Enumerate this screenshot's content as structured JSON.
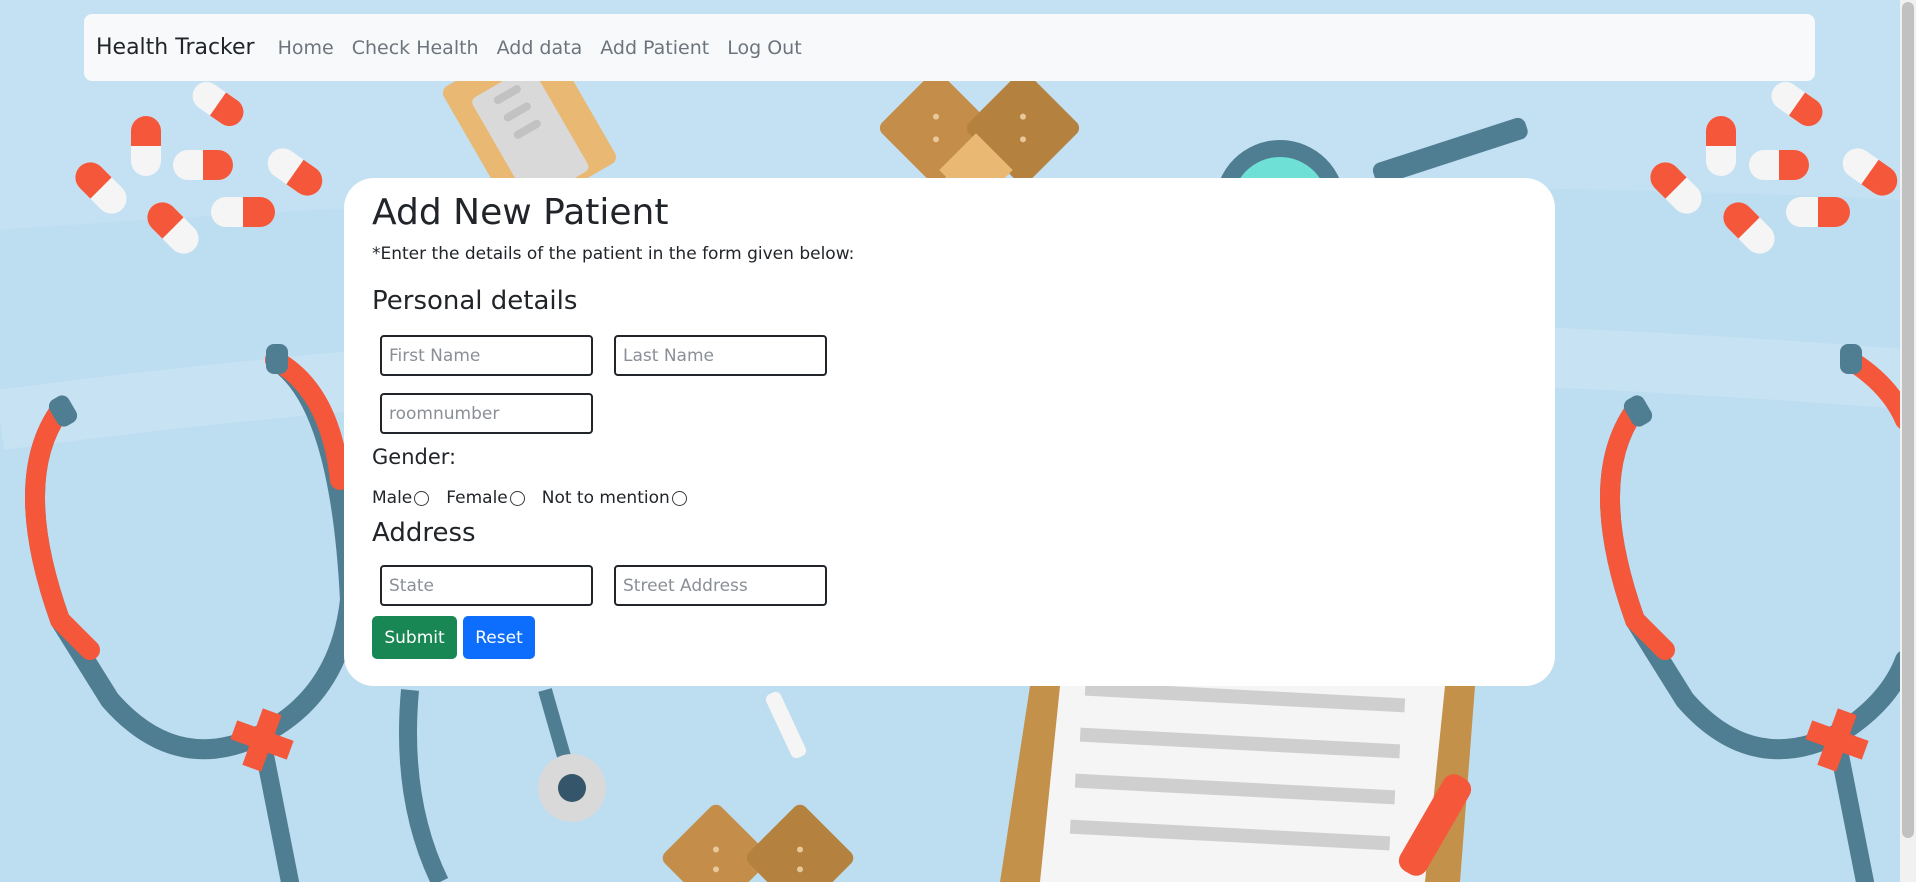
{
  "navbar": {
    "brand": "Health Tracker",
    "links": [
      "Home",
      "Check Health",
      "Add data",
      "Add Patient",
      "Log Out"
    ]
  },
  "form": {
    "title": "Add New Patient",
    "subtitle": "*Enter the details of the patient in the form given below:",
    "personal_heading": "Personal details",
    "first_name_placeholder": "First Name",
    "last_name_placeholder": "Last Name",
    "room_placeholder": "roomnumber",
    "gender_heading": "Gender:",
    "gender_options": [
      "Male",
      "Female",
      "Not to mention"
    ],
    "address_heading": "Address",
    "state_placeholder": "State",
    "street_placeholder": "Street Address",
    "submit_label": "Submit",
    "reset_label": "Reset"
  },
  "colors": {
    "background": "#c3e1f2",
    "submit": "#198754",
    "reset": "#0d6efd",
    "pill_red": "#f5573a",
    "stethoscope": "#4f7d91"
  }
}
